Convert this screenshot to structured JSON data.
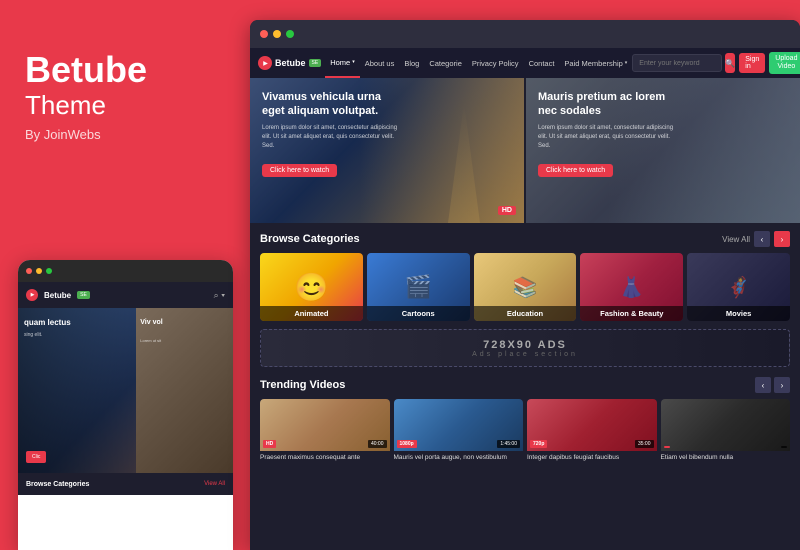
{
  "brand": {
    "name": "Betube",
    "theme": "Theme",
    "by": "By JoinWebs"
  },
  "browser": {
    "nav": {
      "logo": "Betube",
      "badge": "SE",
      "items": [
        {
          "label": "Home",
          "chevron": true,
          "active": true
        },
        {
          "label": "About us",
          "chevron": false
        },
        {
          "label": "Blog",
          "chevron": false
        },
        {
          "label": "Categorie",
          "chevron": false
        },
        {
          "label": "Privacy Policy",
          "chevron": false
        },
        {
          "label": "Contact",
          "chevron": false
        },
        {
          "label": "Paid Membership",
          "chevron": true
        }
      ],
      "search_placeholder": "Enter your keyword",
      "signin": "Sign in",
      "upload_line1": "Upload",
      "upload_line2": "Video"
    },
    "hero": {
      "left": {
        "title": "Vivamus vehicula urna eget aliquam volutpat.",
        "desc": "Lorem ipsum dolor sit amet, consectetur adipiscing elit. Ut sit amet aliquet erat, quis consectetur velit. Sed.",
        "cta": "Click here to watch",
        "badge": "HD"
      },
      "right": {
        "title": "Mauris pretium ac lorem nec sodales",
        "desc": "Lorem ipsum dolor sit amet, consectetur adipiscing elit. Ut sit amet aliquet erat, quis consectetur velit. Sed.",
        "cta": "Click here to watch"
      }
    },
    "categories": {
      "section_title": "Browse Categories",
      "view_all": "View All",
      "items": [
        {
          "label": "Animated",
          "class": "cat-animated"
        },
        {
          "label": "Cartoons",
          "class": "cat-cartoons"
        },
        {
          "label": "Education",
          "class": "cat-education"
        },
        {
          "label": "Fashion & Beauty",
          "class": "cat-fashion"
        },
        {
          "label": "Movies",
          "class": "cat-movies"
        }
      ]
    },
    "ads": {
      "main": "728X90 ADS",
      "sub": "Ads place section"
    },
    "trending": {
      "section_title": "Trending Videos",
      "videos": [
        {
          "title": "Praesent maximus consequat ante",
          "badge": "HD",
          "duration": "40:00",
          "class": "v1"
        },
        {
          "title": "Mauris vel porta augue, non vestibulum",
          "badge": "1080p",
          "duration": "1:45:00",
          "class": "v2"
        },
        {
          "title": "Integer dapibus feugiat faucibus",
          "badge": "720p",
          "duration": "35:00",
          "class": "v3"
        },
        {
          "title": "Etiam vel bibendum nulla",
          "badge": "",
          "duration": "",
          "class": "v4"
        }
      ]
    }
  },
  "mobile": {
    "brand": "Betube",
    "badge": "SE",
    "hero_left_title": "quam lectus",
    "hero_left_text": "sing elit.",
    "hero_right_title": "Viv vol",
    "hero_right_text": "Lorem ut sit",
    "cta": "Clic",
    "bottom_label": "Browse Categories",
    "view_all": "View All"
  }
}
